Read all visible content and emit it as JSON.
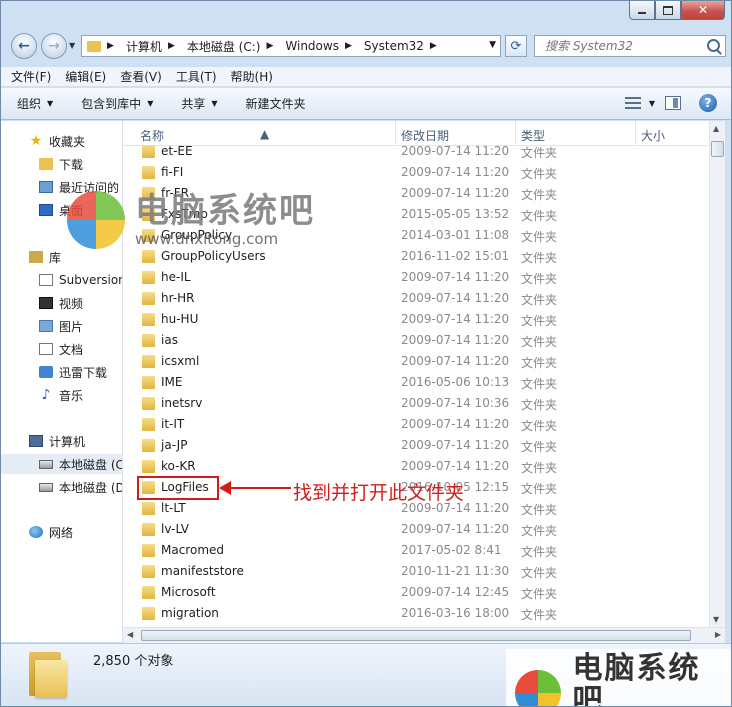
{
  "address": {
    "crumbs": [
      "计算机",
      "本地磁盘 (C:)",
      "Windows",
      "System32"
    ],
    "search_placeholder": "搜索 System32"
  },
  "menu": [
    "文件(F)",
    "编辑(E)",
    "查看(V)",
    "工具(T)",
    "帮助(H)"
  ],
  "toolbar": {
    "organize": "组织",
    "include_library": "包含到库中",
    "share": "共享",
    "new_folder": "新建文件夹"
  },
  "nav": {
    "favorites": "收藏夹",
    "downloads": "下载",
    "recent": "最近访问的",
    "desktop": "桌面",
    "libraries": "库",
    "subversion": "Subversion",
    "videos": "视频",
    "pictures": "图片",
    "documents": "文档",
    "xunlei": "迅雷下载",
    "music": "音乐",
    "computer": "计算机",
    "disk_c": "本地磁盘 (C",
    "disk_d": "本地磁盘 (D",
    "network": "网络"
  },
  "columns": {
    "name": "名称",
    "date": "修改日期",
    "type": "类型",
    "size": "大小"
  },
  "files": [
    {
      "name": "et-EE",
      "date": "2009-07-14 11:20",
      "type": "文件夹"
    },
    {
      "name": "fi-FI",
      "date": "2009-07-14 11:20",
      "type": "文件夹"
    },
    {
      "name": "fr-FR",
      "date": "2009-07-14 11:20",
      "type": "文件夹"
    },
    {
      "name": "FxsTmp",
      "date": "2015-05-05 13:52",
      "type": "文件夹"
    },
    {
      "name": "GroupPolicy",
      "date": "2014-03-01 11:08",
      "type": "文件夹"
    },
    {
      "name": "GroupPolicyUsers",
      "date": "2016-11-02 15:01",
      "type": "文件夹"
    },
    {
      "name": "he-IL",
      "date": "2009-07-14 11:20",
      "type": "文件夹"
    },
    {
      "name": "hr-HR",
      "date": "2009-07-14 11:20",
      "type": "文件夹"
    },
    {
      "name": "hu-HU",
      "date": "2009-07-14 11:20",
      "type": "文件夹"
    },
    {
      "name": "ias",
      "date": "2009-07-14 11:20",
      "type": "文件夹"
    },
    {
      "name": "icsxml",
      "date": "2009-07-14 11:20",
      "type": "文件夹"
    },
    {
      "name": "IME",
      "date": "2016-05-06 10:13",
      "type": "文件夹"
    },
    {
      "name": "inetsrv",
      "date": "2009-07-14 10:36",
      "type": "文件夹"
    },
    {
      "name": "it-IT",
      "date": "2009-07-14 11:20",
      "type": "文件夹"
    },
    {
      "name": "ja-JP",
      "date": "2009-07-14 11:20",
      "type": "文件夹"
    },
    {
      "name": "ko-KR",
      "date": "2009-07-14 11:20",
      "type": "文件夹"
    },
    {
      "name": "LogFiles",
      "date": "2016-10-05 12:15",
      "type": "文件夹"
    },
    {
      "name": "lt-LT",
      "date": "2009-07-14 11:20",
      "type": "文件夹"
    },
    {
      "name": "lv-LV",
      "date": "2009-07-14 11:20",
      "type": "文件夹"
    },
    {
      "name": "Macromed",
      "date": "2017-05-02 8:41",
      "type": "文件夹"
    },
    {
      "name": "manifeststore",
      "date": "2010-11-21 11:30",
      "type": "文件夹"
    },
    {
      "name": "Microsoft",
      "date": "2009-07-14 12:45",
      "type": "文件夹"
    },
    {
      "name": "migration",
      "date": "2016-03-16 18:00",
      "type": "文件夹"
    }
  ],
  "status": {
    "count": "2,850 个对象"
  },
  "annotation": {
    "text": "找到并打开此文件夹"
  },
  "watermark": {
    "title": "电脑系统吧",
    "url": "www.dnxitong.com"
  },
  "colors": {
    "highlight": "#d21d1d",
    "folder": "#e9c24f",
    "logo_red": "#e74c3c",
    "logo_green": "#6cbf3a",
    "logo_blue": "#2e8fd8",
    "logo_yellow": "#f3c12a"
  }
}
